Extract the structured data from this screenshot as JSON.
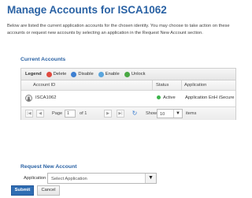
{
  "page": {
    "title": "Manage Accounts for ISCA1062",
    "intro": "Below are listed the current application accounts for the chosen identity. You may choose to take action on these accounts or request new accounts by selecting an application in the Request New Account section."
  },
  "current_accounts": {
    "title": "Current Accounts",
    "legend": {
      "label": "Legend",
      "items": [
        {
          "label": "Delete",
          "icon": "delete-icon",
          "color": "#e04a3f"
        },
        {
          "label": "Disable",
          "icon": "disable-icon",
          "color": "#3d7fd1"
        },
        {
          "label": "Enable",
          "icon": "enable-icon",
          "color": "#5aa5dd"
        },
        {
          "label": "Unlock",
          "icon": "unlock-icon",
          "color": "#49a843"
        }
      ]
    },
    "columns": {
      "account_id": "Account ID",
      "status": "Status",
      "application": "Application"
    },
    "rows": [
      {
        "account_id": "ISCA1062",
        "status": "Active",
        "status_color": "#3bb34a",
        "application": "Application EnH iSecure"
      }
    ],
    "pager": {
      "page_label": "Page",
      "page_value": "1",
      "of_label": "of 1",
      "show_label": "Show",
      "show_value": "10",
      "items_label": "items"
    }
  },
  "request_new": {
    "title": "Request New Account",
    "application_label": "Application",
    "application_value": "Select Application"
  },
  "actions": {
    "submit": "Submit",
    "cancel": "Cancel"
  }
}
